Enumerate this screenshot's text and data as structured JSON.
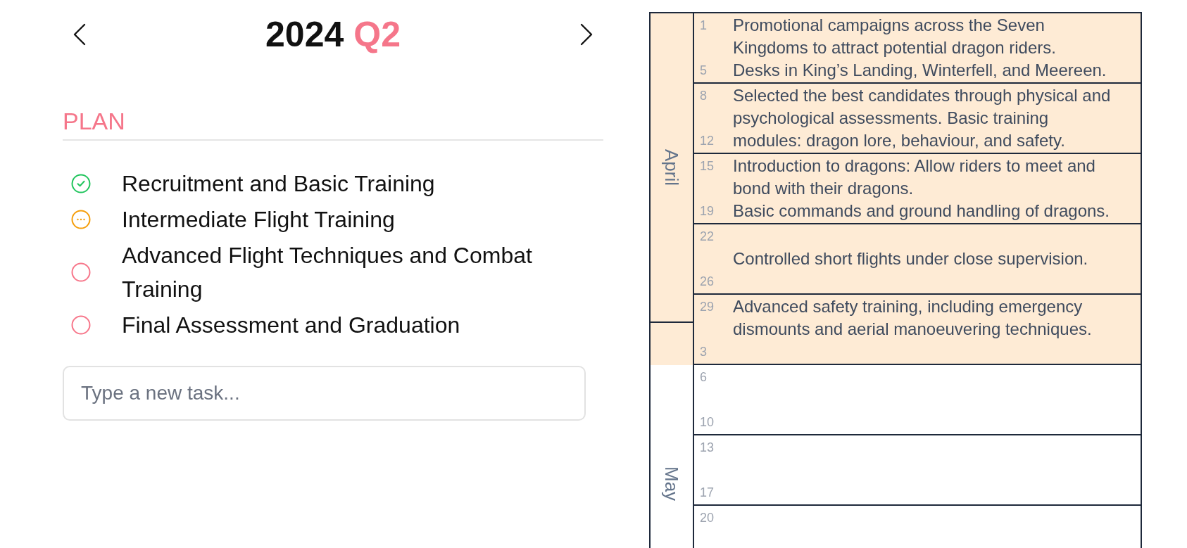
{
  "header": {
    "year": "2024",
    "quarter": "Q2"
  },
  "plan": {
    "heading": "PLAN",
    "tasks": [
      {
        "label": "Recruitment and Basic Training",
        "done": true,
        "in_progress": false
      },
      {
        "label": "Intermediate Flight Training",
        "done": false,
        "in_progress": true
      },
      {
        "label": "Advanced Flight Techniques and Combat Training",
        "done": false,
        "in_progress": false
      },
      {
        "label": "Final Assessment and Graduation",
        "done": false,
        "in_progress": false
      }
    ],
    "new_task": {
      "placeholder": "Type a new task..."
    }
  },
  "calendar": {
    "months": [
      {
        "name": "April"
      },
      {
        "name": "May"
      }
    ],
    "weeks": [
      {
        "first_day": "1",
        "last_day": "5",
        "highlighted": true,
        "kind": "listed",
        "notes": [
          "Promotional campaigns across the Seven Kingdoms to attract potential dragon riders.",
          "Desks in King’s Landing, Winterfell, and Meereen."
        ]
      },
      {
        "first_day": "8",
        "last_day": "12",
        "highlighted": true,
        "kind": "listed",
        "notes": [
          "Selected the best candidates through physical and psychological assessments. Basic training modules: dragon lore, behaviour, and safety."
        ]
      },
      {
        "first_day": "15",
        "last_day": "19",
        "highlighted": true,
        "kind": "listed",
        "notes": [
          "Introduction to dragons: Allow riders to meet and bond with their dragons.",
          "Basic commands and ground handling of dragons."
        ]
      },
      {
        "first_day": "22",
        "last_day": "26",
        "highlighted": true,
        "kind": "centered",
        "notes": [
          "Controlled short flights under close supervision."
        ]
      },
      {
        "first_day": "29",
        "last_day": "3",
        "highlighted": true,
        "kind": "listed",
        "notes": [
          "Advanced safety training, including emergency dismounts and aerial manoeuvering techniques."
        ]
      },
      {
        "first_day": "6",
        "last_day": "10",
        "highlighted": false,
        "kind": "listed"
      },
      {
        "first_day": "13",
        "last_day": "17",
        "highlighted": false,
        "kind": "listed"
      },
      {
        "first_day": "20",
        "highlighted": false,
        "kind": "listed"
      }
    ]
  }
}
